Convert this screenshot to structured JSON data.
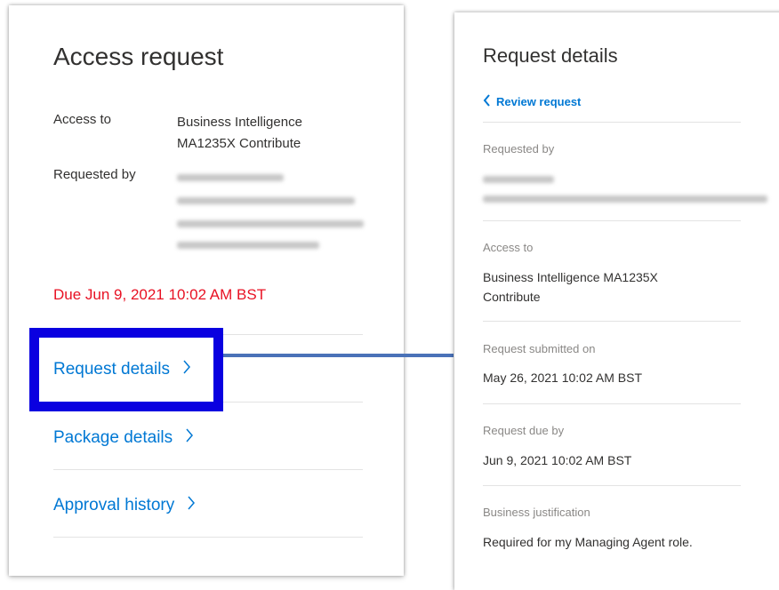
{
  "access_card": {
    "title": "Access request",
    "access_to_label": "Access to",
    "access_to_value_line1": "Business Intelligence",
    "access_to_value_line2": "MA1235X Contribute",
    "requested_by_label": "Requested by",
    "due_text": "Due Jun 9, 2021 10:02 AM BST",
    "links": {
      "request_details": "Request details",
      "package_details": "Package details",
      "approval_history": "Approval history"
    }
  },
  "details_card": {
    "title": "Request details",
    "back_link": "Review request",
    "requested_by_label": "Requested by",
    "access_to_label": "Access to",
    "access_to_value_line1": "Business Intelligence MA1235X",
    "access_to_value_line2": "Contribute",
    "submitted_label": "Request submitted on",
    "submitted_value": "May 26, 2021 10:02 AM BST",
    "due_label": "Request due by",
    "due_value": "Jun 9, 2021 10:02 AM BST",
    "justification_label": "Business justification",
    "justification_value": "Required for my Managing Agent role."
  },
  "colors": {
    "link": "#0078d4",
    "due_warning": "#e81123",
    "highlight_box": "#0a00e0",
    "connector": "#4a72b8"
  },
  "icons": {
    "link_chevron": "chevron-right-icon",
    "back_chevron": "chevron-left-icon"
  }
}
